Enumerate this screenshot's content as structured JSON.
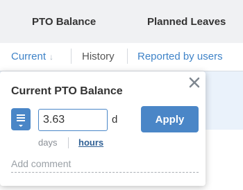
{
  "tabs": {
    "pto_balance": "PTO Balance",
    "planned_leaves": "Planned Leaves"
  },
  "subnav": {
    "current": "Current",
    "history": "History",
    "reported": "Reported by users"
  },
  "popover": {
    "title": "Current PTO Balance",
    "value": "3.63",
    "unit": "d",
    "apply_label": "Apply",
    "days_label": "days",
    "hours_label": "hours",
    "comment_placeholder": "Add comment"
  },
  "colors": {
    "accent": "#4a86c7",
    "link": "#3f83c8",
    "header_bg": "#f0f1f3"
  },
  "icons": [
    "sort-down-arrow-icon",
    "close-icon",
    "menu-icon"
  ]
}
